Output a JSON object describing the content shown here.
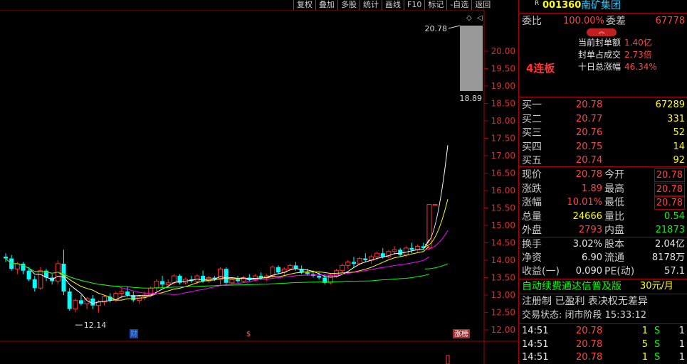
{
  "toolbar": [
    "复权",
    "叠加",
    "多股",
    "统计",
    "画线",
    "F10",
    "标记",
    "-自选",
    "返回"
  ],
  "stock": {
    "code": "001360",
    "name": "南矿集团",
    "badge": "R"
  },
  "seal": {
    "ratio_label": "委比",
    "ratio_value": "100.00%",
    "diff_label": "委差",
    "diff_value": "67778",
    "streak": "4连板",
    "stats": [
      {
        "label": "当前封单额",
        "value": "1.40亿"
      },
      {
        "label": "封单占成交",
        "value": "2.73倍"
      },
      {
        "label": "十日总涨幅",
        "value": "46.34%"
      }
    ]
  },
  "bids": [
    {
      "label": "买一",
      "price": "20.78",
      "vol": "67289"
    },
    {
      "label": "买二",
      "price": "20.77",
      "vol": "331"
    },
    {
      "label": "买三",
      "price": "20.76",
      "vol": "52"
    },
    {
      "label": "买四",
      "price": "20.75",
      "vol": "14"
    },
    {
      "label": "买五",
      "price": "20.74",
      "vol": "92"
    }
  ],
  "quote": [
    {
      "l1": "现价",
      "v1": "20.78",
      "l2": "今开",
      "v2": "20.78"
    },
    {
      "l1": "涨跌",
      "v1": "1.89",
      "l2": "最高",
      "v2": "20.78"
    },
    {
      "l1": "涨幅",
      "v1": "10.01%",
      "l2": "最低",
      "v2": "20.78"
    },
    {
      "l1": "总量",
      "v1": "24666",
      "l2": "量比",
      "v2": "0.54"
    },
    {
      "l1": "外盘",
      "v1": "2793",
      "l2": "内盘",
      "v2": "21873"
    }
  ],
  "fundamentals": [
    {
      "l1": "换手",
      "v1": "3.02%",
      "l2": "股本",
      "v2": "2.04亿"
    },
    {
      "l1": "净资",
      "v1": "6.90",
      "l2": "流通",
      "v2": "8178万"
    },
    {
      "l1": "收益(一)",
      "v1": "0.090",
      "l2": "PE(动)",
      "v2": "57.1"
    }
  ],
  "promo": {
    "text": "自动续费通达信普及版",
    "price": "30元/月"
  },
  "status": {
    "tags": "注册制 已盈利 表决权无差异",
    "trade": "交易状态: 闭市阶段 15:33:12"
  },
  "ticks": [
    {
      "time": "14:51",
      "price": "20.78",
      "vol": "1",
      "side": "S",
      "n": "1"
    },
    {
      "time": "14:51",
      "price": "20.78",
      "vol": "5",
      "side": "S",
      "n": "1"
    },
    {
      "time": "14:51",
      "price": "20.78",
      "vol": "1",
      "side": "S",
      "n": "1"
    }
  ],
  "chart_data": {
    "type": "candlestick",
    "y_ticks": [
      "20.00",
      "19.50",
      "19.00",
      "18.50",
      "18.00",
      "17.50",
      "17.00",
      "16.50",
      "16.00",
      "15.50",
      "15.00",
      "14.50",
      "14.00",
      "13.50",
      "13.00",
      "12.50",
      "12.00"
    ],
    "high_label": "20.78",
    "low_label": "12.14",
    "preview_bottom_label": "18.89",
    "markers": [
      "财",
      "$",
      "涨榜"
    ],
    "candles_ohlc": [
      [
        14.1,
        14.2,
        13.95,
        14.05
      ],
      [
        14.05,
        14.15,
        13.7,
        13.75
      ],
      [
        13.75,
        13.95,
        13.6,
        13.9
      ],
      [
        13.9,
        13.95,
        13.6,
        13.7
      ],
      [
        13.7,
        13.8,
        13.4,
        13.45
      ],
      [
        13.45,
        13.55,
        13.1,
        13.2
      ],
      [
        13.2,
        13.8,
        13.15,
        13.7
      ],
      [
        13.7,
        13.75,
        13.4,
        13.5
      ],
      [
        13.5,
        13.6,
        13.3,
        13.4
      ],
      [
        13.4,
        14.0,
        13.3,
        13.9
      ],
      [
        13.9,
        14.3,
        13.0,
        13.1
      ],
      [
        13.1,
        13.2,
        12.55,
        12.6
      ],
      [
        12.6,
        12.9,
        12.5,
        12.85
      ],
      [
        12.85,
        13.0,
        12.7,
        12.75
      ],
      [
        12.75,
        12.95,
        12.6,
        12.9
      ],
      [
        12.9,
        13.0,
        12.6,
        12.7
      ],
      [
        12.7,
        12.85,
        12.5,
        12.8
      ],
      [
        12.8,
        13.0,
        12.7,
        12.95
      ],
      [
        12.95,
        13.05,
        12.8,
        12.85
      ],
      [
        12.85,
        13.1,
        12.8,
        13.05
      ],
      [
        13.05,
        13.2,
        12.9,
        13.1
      ],
      [
        13.1,
        13.25,
        12.95,
        13.0
      ],
      [
        13.0,
        13.1,
        12.8,
        12.85
      ],
      [
        12.85,
        13.0,
        12.75,
        12.95
      ],
      [
        12.95,
        13.1,
        12.85,
        13.0
      ],
      [
        13.0,
        13.25,
        12.95,
        13.2
      ],
      [
        13.2,
        13.45,
        13.1,
        13.4
      ],
      [
        13.4,
        13.55,
        13.2,
        13.3
      ],
      [
        13.3,
        13.45,
        13.2,
        13.35
      ],
      [
        13.35,
        13.6,
        13.3,
        13.55
      ],
      [
        13.55,
        13.6,
        13.3,
        13.35
      ],
      [
        13.35,
        13.5,
        13.3,
        13.45
      ],
      [
        13.45,
        13.55,
        13.35,
        13.4
      ],
      [
        13.4,
        13.6,
        13.3,
        13.55
      ],
      [
        13.55,
        13.7,
        13.35,
        13.4
      ],
      [
        13.4,
        13.55,
        13.35,
        13.5
      ],
      [
        13.5,
        13.55,
        13.4,
        13.45
      ],
      [
        13.45,
        13.8,
        13.3,
        13.75
      ],
      [
        13.75,
        13.8,
        13.3,
        13.35
      ],
      [
        13.35,
        13.5,
        13.3,
        13.45
      ],
      [
        13.45,
        13.55,
        13.35,
        13.4
      ],
      [
        13.4,
        13.55,
        13.35,
        13.5
      ],
      [
        13.5,
        13.6,
        13.4,
        13.45
      ],
      [
        13.45,
        13.6,
        13.4,
        13.55
      ],
      [
        13.55,
        13.65,
        13.45,
        13.5
      ],
      [
        13.5,
        13.6,
        13.4,
        13.55
      ],
      [
        13.55,
        13.85,
        13.5,
        13.8
      ],
      [
        13.8,
        13.85,
        13.6,
        13.65
      ],
      [
        13.65,
        13.8,
        13.55,
        13.75
      ],
      [
        13.75,
        13.9,
        13.7,
        13.85
      ],
      [
        13.85,
        13.95,
        13.7,
        13.75
      ],
      [
        13.75,
        13.85,
        13.6,
        13.65
      ],
      [
        13.65,
        13.75,
        13.55,
        13.6
      ],
      [
        13.6,
        13.7,
        13.5,
        13.55
      ],
      [
        13.55,
        13.65,
        13.45,
        13.5
      ],
      [
        13.5,
        13.6,
        13.3,
        13.35
      ],
      [
        13.35,
        13.6,
        13.3,
        13.55
      ],
      [
        13.55,
        13.75,
        13.5,
        13.7
      ],
      [
        13.7,
        13.9,
        13.65,
        13.85
      ],
      [
        13.85,
        14.0,
        13.75,
        13.95
      ],
      [
        13.95,
        14.1,
        13.8,
        13.9
      ],
      [
        13.9,
        14.1,
        13.85,
        14.05
      ],
      [
        14.05,
        14.2,
        13.95,
        14.0
      ],
      [
        14.0,
        14.15,
        13.9,
        14.1
      ],
      [
        14.1,
        14.25,
        14.0,
        14.2
      ],
      [
        14.2,
        14.35,
        14.05,
        14.1
      ],
      [
        14.1,
        14.3,
        14.05,
        14.25
      ],
      [
        14.25,
        14.4,
        14.15,
        14.3
      ],
      [
        14.3,
        14.35,
        14.1,
        14.15
      ],
      [
        14.15,
        14.4,
        14.1,
        14.35
      ],
      [
        14.35,
        14.5,
        14.2,
        14.3
      ],
      [
        14.3,
        14.45,
        14.25,
        14.4
      ],
      [
        14.4,
        14.5,
        14.3,
        14.35
      ],
      [
        14.35,
        15.6,
        14.3,
        15.6
      ],
      [
        15.6,
        15.6,
        15.6,
        15.6
      ]
    ]
  }
}
